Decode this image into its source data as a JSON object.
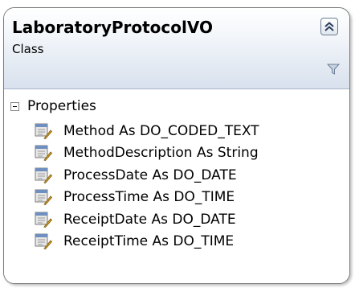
{
  "shape": {
    "class_name": "LaboratoryProtocolVO",
    "class_kind": "Class",
    "collapse_icon": "double-chevron-up-icon",
    "filter_icon": "filter-icon"
  },
  "section": {
    "toggle_icon": "collapse-minus-icon",
    "label": "Properties"
  },
  "members": [
    {
      "label": "Method As DO_CODED_TEXT",
      "icon": "property-icon"
    },
    {
      "label": "MethodDescription As String",
      "icon": "property-icon"
    },
    {
      "label": "ProcessDate As DO_DATE",
      "icon": "property-icon"
    },
    {
      "label": "ProcessTime As DO_TIME",
      "icon": "property-icon"
    },
    {
      "label": "ReceiptDate As DO_DATE",
      "icon": "property-icon"
    },
    {
      "label": "ReceiptTime As DO_TIME",
      "icon": "property-icon"
    }
  ]
}
